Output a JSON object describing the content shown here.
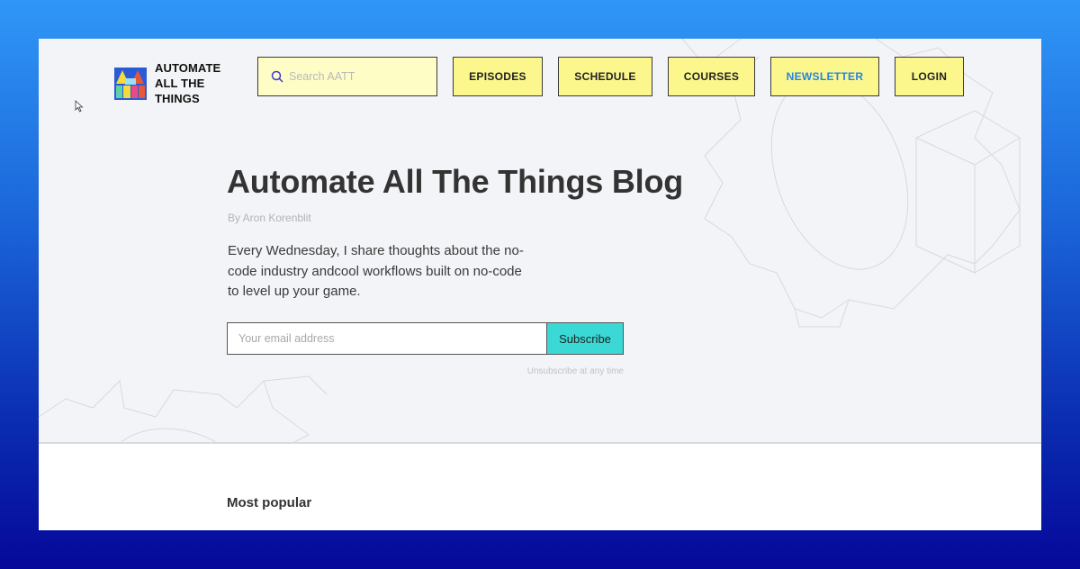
{
  "header": {
    "logo_text": "AUTOMATE ALL THE THINGS",
    "search_placeholder": "Search AATT",
    "nav": [
      {
        "label": "EPISODES"
      },
      {
        "label": "SCHEDULE"
      },
      {
        "label": "COURSES"
      },
      {
        "label": "NEWSLETTER",
        "active": true
      },
      {
        "label": "LOGIN"
      }
    ]
  },
  "hero": {
    "title": "Automate All The Things Blog",
    "byline": "By Aron Korenblit",
    "description": "Every Wednesday, I share thoughts about the no-code industry andcool workflows built on no-code to level up your game.",
    "email_placeholder": "Your email address",
    "subscribe_label": "Subscribe",
    "unsubscribe_note": "Unsubscribe at any time"
  },
  "content": {
    "section_title": "Most popular"
  },
  "icons": {
    "search": "search-icon",
    "logo": "aatt-logo-icon",
    "cursor": "mouse-cursor-icon"
  },
  "colors": {
    "nav_button_bg": "#fbf78c",
    "search_bg": "#fffdc6",
    "subscribe_bg": "#3ad9d6",
    "active_nav_text": "#2784e0",
    "hero_bg": "#f3f4f7"
  }
}
